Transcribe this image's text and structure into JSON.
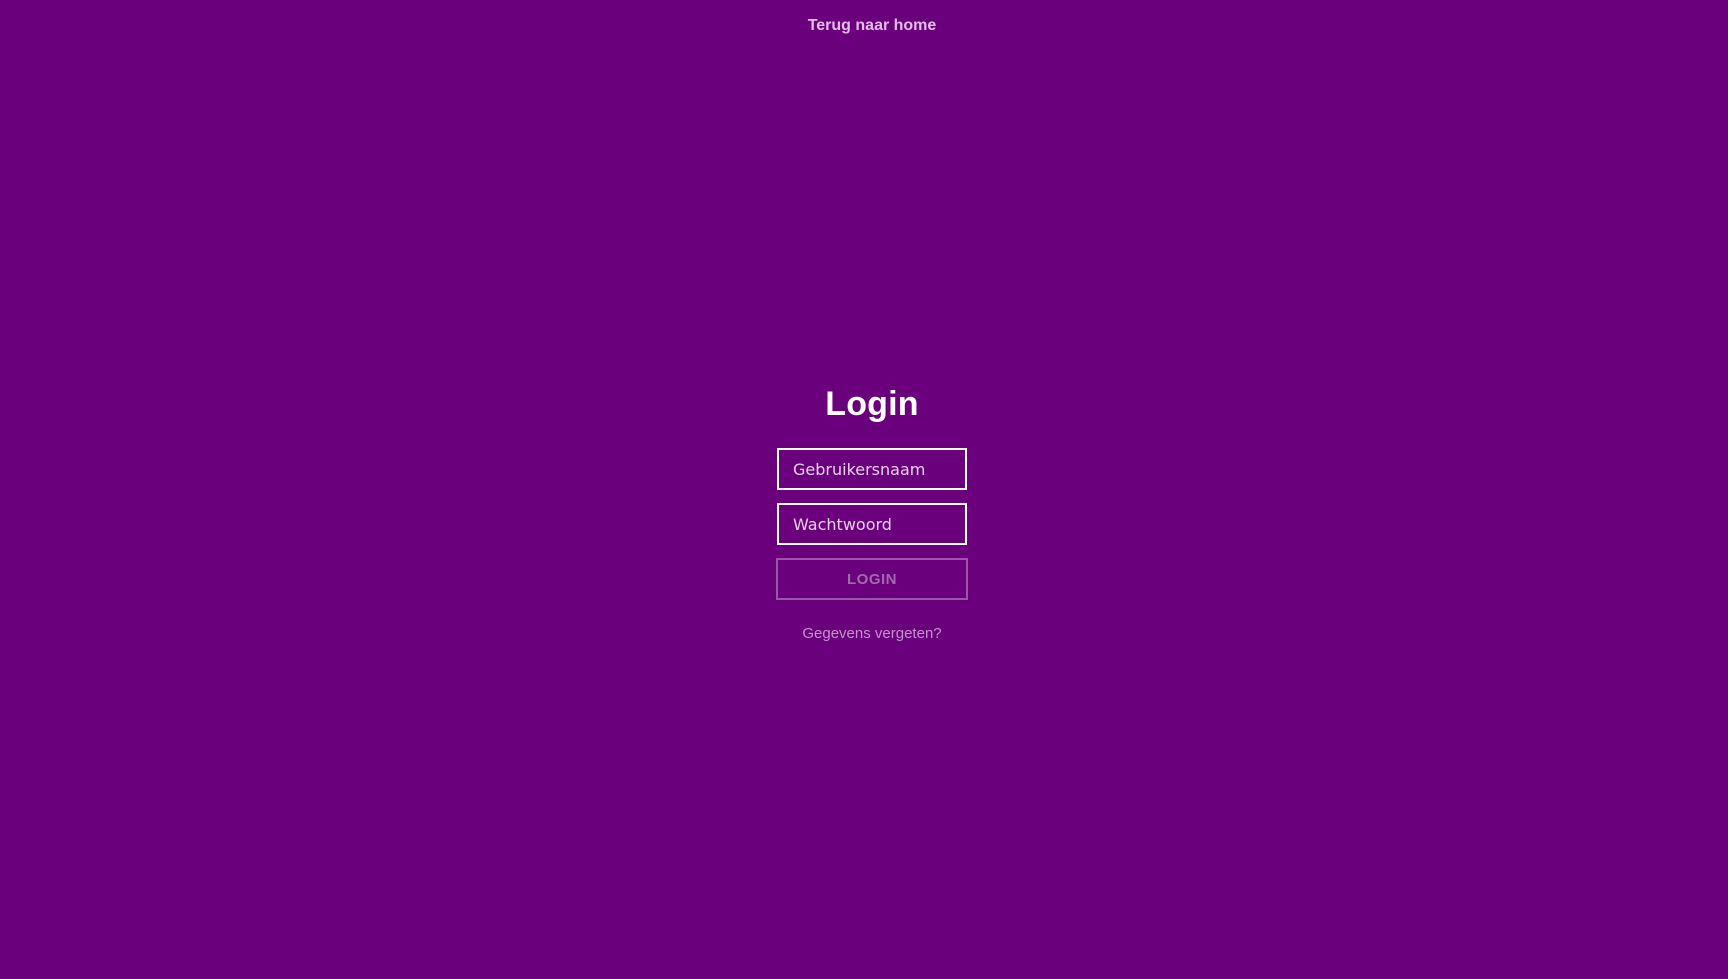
{
  "nav": {
    "home_link": "Terug naar home"
  },
  "login": {
    "title": "Login",
    "username_placeholder": "Gebruikersnaam",
    "password_placeholder": "Wachtwoord",
    "submit_label": "LOGIN",
    "forgot_link": "Gegevens vergeten?"
  },
  "colors": {
    "background": "#6a007c",
    "title_text": "#ffffff",
    "input_border": "#ffffff",
    "button_border_disabled": "#9d55ab",
    "button_text_disabled": "#a26aae",
    "link_text": "#c394cc",
    "home_link_text": "#e2bde8"
  }
}
